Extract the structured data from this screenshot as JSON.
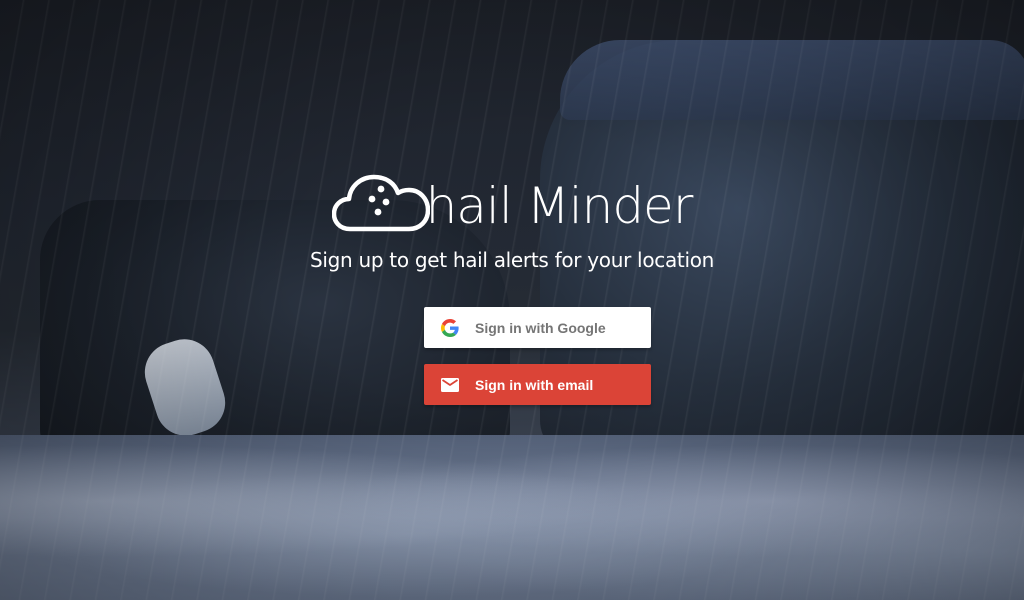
{
  "brand": {
    "name": "hail Minder",
    "tagline": "Sign up to get hail alerts for your location"
  },
  "auth": {
    "google_label": "Sign in with Google",
    "email_label": "Sign in with email"
  },
  "colors": {
    "google_button_bg": "#ffffff",
    "google_button_text": "#757575",
    "email_button_bg": "#db4437",
    "email_button_text": "#ffffff",
    "brand_text": "#ffffff"
  },
  "icons": {
    "logo": "cloud-hail-icon",
    "google": "google-g-icon",
    "email": "mail-envelope-icon"
  }
}
